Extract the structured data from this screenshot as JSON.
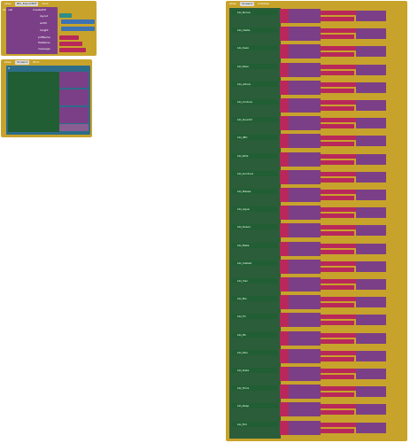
{
  "colors": {
    "event": "#c8a32b",
    "call": "#7b3f87",
    "text": "#b8285a",
    "control": "#215e33",
    "math": "#3d72b4"
  },
  "ev1": {
    "when": "when",
    "component": "Btn_ExportPDF",
    "event": "Click",
    "do": "do",
    "call": "call",
    "method": "CreatePdf",
    "layout": "layout",
    "width": "width",
    "height": "height",
    "pdfName": "pdfName",
    "fileName": "fileName",
    "message": "message",
    "arr": "ARR_PORTRAIT",
    "calibri": "Calibri",
    "dim1": "Dimensio",
    "dim2": "Dimensio",
    "screen": "ScreenShot",
    "toast": "Toast"
  },
  "ev2": {
    "when": "when",
    "component": "Screen1",
    "event": "Error",
    "do": "do",
    "if": "if",
    "then": "then",
    "else": "else",
    "call": "call",
    "notifier": "Notifier1",
    "method1": "ShowAlert",
    "method2": "ShowAlert"
  },
  "ev3": {
    "when": "when",
    "component": "Screen1",
    "event": "Initialize",
    "do": "do",
    "set": "set",
    "to": "to",
    "joined": "join",
    "call": "call",
    "tinydb": "TinyDB1",
    "getvalue": "GetValue",
    "tag": "tag",
    "ifempty": "valueIfTagNotThere",
    "na": "Não informado"
  },
  "rows": [
    "Lbl_Nome",
    "Lbl_Idade",
    "Lbl_Sexo",
    "Lbl_Peso",
    "Lbl_Altura",
    "Lbl_Cintura",
    "Lbl_Quadril",
    "Lbl_IMC",
    "Lbl_RCQ",
    "Lbl_Gordura",
    "Lbl_Massa",
    "Lbl_Agua",
    "Lbl_Ossos",
    "Lbl_Meta",
    "Lbl_Idade2",
    "Lbl_Visc",
    "Lbl_Bio",
    "Lbl_FC",
    "Lbl_PA",
    "Lbl_Obs",
    "Lbl_Data",
    "Lbl_Hora",
    "Lbl_Resp",
    "Lbl_Fim"
  ]
}
